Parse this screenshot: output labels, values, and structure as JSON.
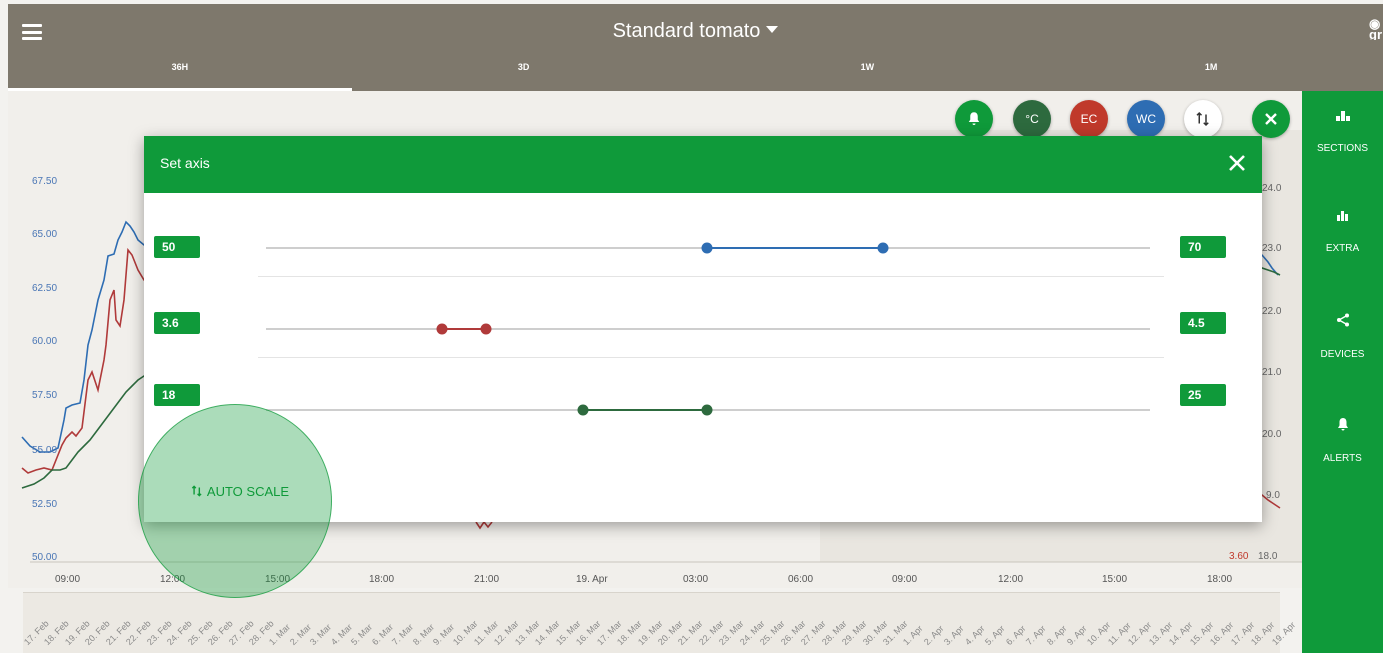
{
  "header": {
    "title": "Standard tomato",
    "corner_text": "gr",
    "tabs": [
      {
        "label": "36H",
        "active": true
      },
      {
        "label": "3D",
        "active": false
      },
      {
        "label": "1W",
        "active": false
      },
      {
        "label": "1M",
        "active": false
      }
    ]
  },
  "sidebar": {
    "items": [
      {
        "label": "SECTIONS",
        "icon": "sections-icon"
      },
      {
        "label": "EXTRA",
        "icon": "bar-chart-icon"
      },
      {
        "label": "DEVICES",
        "icon": "share-icon"
      },
      {
        "label": "ALERTS",
        "icon": "bell-icon"
      }
    ]
  },
  "toolbar": {
    "temp_label": "°C",
    "ec_label": "EC",
    "wc_label": "WC"
  },
  "chart": {
    "y_left": [
      "67.50",
      "65.00",
      "62.50",
      "60.00",
      "57.50",
      "55.00",
      "52.50",
      "50.00"
    ],
    "y_right_partial": [
      "24.0",
      "23.0",
      "22.0",
      "21.0",
      "20.0",
      "9.0"
    ],
    "y_right_bottom_ec": "3.60",
    "y_right_bottom_temp": "18.0",
    "x_labels": [
      "09:00",
      "12:00",
      "15:00",
      "18:00",
      "21:00",
      "19. Apr",
      "03:00",
      "06:00",
      "09:00",
      "12:00",
      "15:00",
      "18:00"
    ],
    "nav_dates": [
      "17. Feb",
      "18. Feb",
      "19. Feb",
      "20. Feb",
      "21. Feb",
      "22. Feb",
      "23. Feb",
      "24. Feb",
      "25. Feb",
      "26. Feb",
      "27. Feb",
      "28. Feb",
      "1. Mar",
      "2. Mar",
      "3. Mar",
      "4. Mar",
      "5. Mar",
      "6. Mar",
      "7. Mar",
      "8. Mar",
      "9. Mar",
      "10. Mar",
      "11. Mar",
      "12. Mar",
      "13. Mar",
      "14. Mar",
      "15. Mar",
      "16. Mar",
      "17. Mar",
      "18. Mar",
      "19. Mar",
      "20. Mar",
      "21. Mar",
      "22. Mar",
      "23. Mar",
      "24. Mar",
      "25. Mar",
      "26. Mar",
      "27. Mar",
      "28. Mar",
      "29. Mar",
      "30. Mar",
      "31. Mar",
      "1. Apr",
      "2. Apr",
      "3. Apr",
      "4. Apr",
      "5. Apr",
      "6. Apr",
      "7. Apr",
      "8. Apr",
      "9. Apr",
      "10. Apr",
      "11. Apr",
      "12. Apr",
      "13. Apr",
      "14. Apr",
      "15. Apr",
      "16. Apr",
      "17. Apr",
      "18. Apr",
      "19. Apr"
    ]
  },
  "modal": {
    "title": "Set axis",
    "auto_scale_label": "AUTO SCALE",
    "sliders": [
      {
        "name": "wc",
        "min_label": "50",
        "max_label": "70",
        "color": "#2e6db3",
        "low_fraction": 0.5,
        "high_fraction": 0.7
      },
      {
        "name": "ec",
        "min_label": "3.6",
        "max_label": "4.5",
        "color": "#b03a3a",
        "low_fraction": 0.2,
        "high_fraction": 0.25
      },
      {
        "name": "temp",
        "min_label": "18",
        "max_label": "25",
        "color": "#2d6a3e",
        "low_fraction": 0.36,
        "high_fraction": 0.5
      }
    ]
  },
  "colors": {
    "brand_green": "#0f9a3a",
    "header_grey": "#7e786c",
    "wc_blue": "#2e6db3",
    "ec_red": "#b03a3a",
    "temp_green": "#2d6a3e"
  }
}
